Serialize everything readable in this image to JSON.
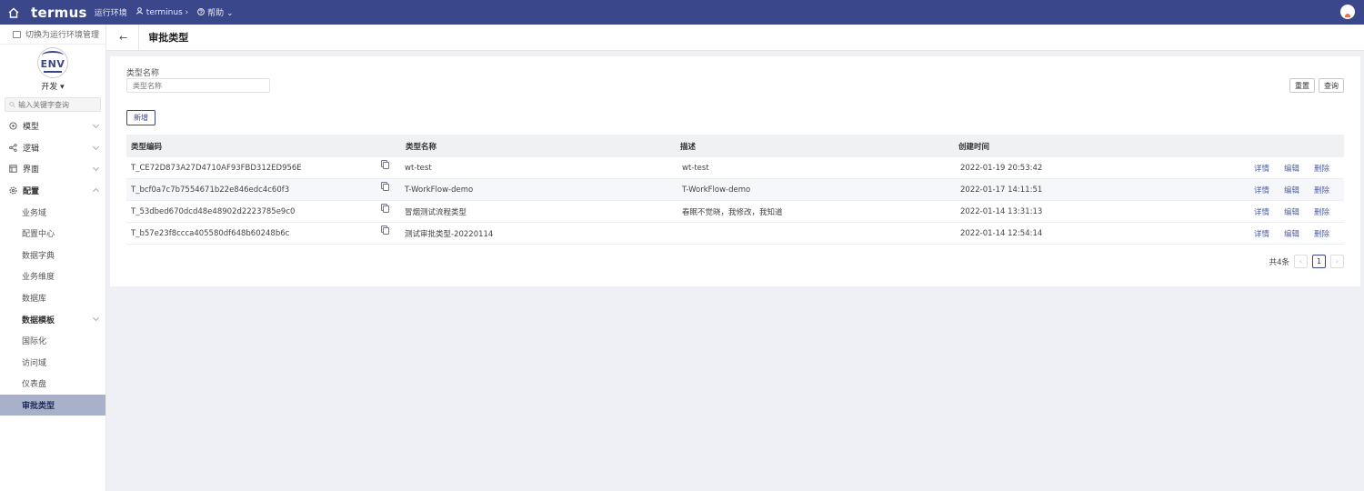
{
  "topbar": {
    "logo": "termus",
    "runtime_env": "运行环境",
    "tenant": "terminus",
    "tenant_chevron": "›",
    "help": "帮助",
    "help_chevron": "⌄"
  },
  "sidebar": {
    "switch_env": "切换为运行环境管理",
    "env_logo_text": "ENV",
    "env_selected": "开发 ▾",
    "search_placeholder": "输入关键字查询",
    "menu": [
      {
        "label": "模型",
        "icon": "model-icon"
      },
      {
        "label": "逻辑",
        "icon": "logic-icon"
      },
      {
        "label": "界面",
        "icon": "ui-icon"
      },
      {
        "label": "配置",
        "icon": "config-icon"
      }
    ],
    "config_children": [
      "业务域",
      "配置中心",
      "数据字典",
      "业务维度",
      "数据库",
      "数据模板",
      "国际化",
      "访问域",
      "仪表盘",
      "审批类型"
    ]
  },
  "page": {
    "back": "←",
    "title": "审批类型"
  },
  "filter": {
    "label": "类型名称",
    "placeholder": "类型名称",
    "reset": "重置",
    "query": "查询",
    "add": "新增"
  },
  "table": {
    "headers": [
      "类型编码",
      "类型名称",
      "描述",
      "创建时间"
    ],
    "rows": [
      {
        "code": "T_CE72D873A27D4710AF93FBD312ED956E",
        "name": "wt-test",
        "desc": "wt-test",
        "created": "2022-01-19 20:53:42"
      },
      {
        "code": "T_bcf0a7c7b7554671b22e846edc4c60f3",
        "name": "T-WorkFlow-demo",
        "desc": "T-WorkFlow-demo",
        "created": "2022-01-17 14:11:51"
      },
      {
        "code": "T_53dbed670dcd48e48902d2223785e9c0",
        "name": "冒烟测试流程类型",
        "desc": "春眠不觉晓，我修改，我知道",
        "created": "2022-01-14 13:31:13"
      },
      {
        "code": "T_b57e23f8ccca405580df648b60248b6c",
        "name": "测试审批类型-20220114",
        "desc": "",
        "created": "2022-01-14 12:54:14"
      }
    ],
    "actions": [
      "详情",
      "编辑",
      "删除"
    ]
  },
  "pager": {
    "total": "共4条",
    "prev": "‹",
    "current": "1",
    "next": "›"
  },
  "colors": {
    "brand": "#3a478a",
    "active_menu": "#a9b0c9",
    "link": "#4f5fa8"
  }
}
